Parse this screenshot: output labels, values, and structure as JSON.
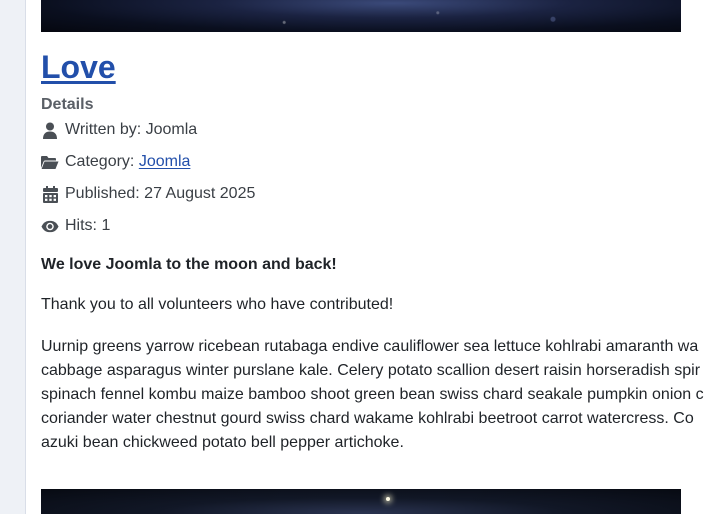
{
  "article": {
    "title": "Love",
    "details_heading": "Details",
    "meta": {
      "author_label": "Written by: Joomla",
      "category_label": "Category: ",
      "category_link": "Joomla",
      "published_label": "Published: 27 August 2025",
      "hits_label": "Hits: 1"
    },
    "lead": "We love Joomla to the moon and back!",
    "paragraph1": "Thank you to all volunteers who have contributed!",
    "paragraph2_lines": [
      "Uurnip greens yarrow ricebean rutabaga endive cauliflower sea lettuce kohlrabi amaranth wa",
      "cabbage asparagus winter purslane kale. Celery potato scallion desert raisin horseradish spir",
      "spinach fennel kombu maize bamboo shoot green bean swiss chard seakale pumpkin onion c",
      "coriander water chestnut gourd swiss chard wakame kohlrabi beetroot carrot watercress. Co",
      "azuki bean chickweed potato bell pepper artichoke."
    ]
  },
  "icons": {
    "author": "user-icon",
    "category": "folder-open-icon",
    "published": "calendar-icon",
    "hits": "eye-icon"
  },
  "colors": {
    "link": "#224faa",
    "text": "#1f2328",
    "meta_text": "#3a3f45",
    "icon": "#4a4f55"
  }
}
